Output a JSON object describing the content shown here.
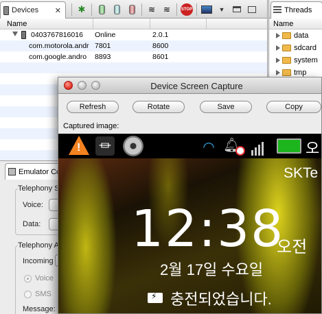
{
  "devices_view": {
    "tab_label": "Devices",
    "columns": [
      "Name"
    ],
    "device": {
      "serial": "0403767816016",
      "state": "Online",
      "version": "2.0.1"
    },
    "processes": [
      {
        "name": "com.motorola.andr",
        "pid": "7801",
        "port": "8600"
      },
      {
        "name": "com.google.andro",
        "pid": "8893",
        "port": "8601"
      }
    ]
  },
  "threads_view": {
    "tab_label": "Threads",
    "column": "Name",
    "folders": [
      "data",
      "sdcard",
      "system",
      "tmp"
    ]
  },
  "emulator_view": {
    "tab_label": "Emulator Control",
    "telephony_status_label": "Telephony S",
    "voice_label": "Voice:",
    "data_label": "Data:",
    "telephony_actions_label": "Telephony A",
    "incoming_label": "Incoming",
    "voice_radio": "Voice",
    "sms_radio": "SMS",
    "message_label": "Message:"
  },
  "capture_dialog": {
    "title": "Device Screen Capture",
    "buttons": {
      "refresh": "Refresh",
      "rotate": "Rotate",
      "save": "Save",
      "copy": "Copy"
    },
    "captured_label": "Captured image:"
  },
  "phone": {
    "statusbar_text": "오",
    "carrier": "SKTe",
    "time": "12:38",
    "ampm": "오전",
    "date": "2월 17일 수요일",
    "charging": "충전되었습니다."
  },
  "colors": {
    "battery": "#1db51d",
    "warning": "#f58220",
    "wifi": "#36a8e0"
  }
}
